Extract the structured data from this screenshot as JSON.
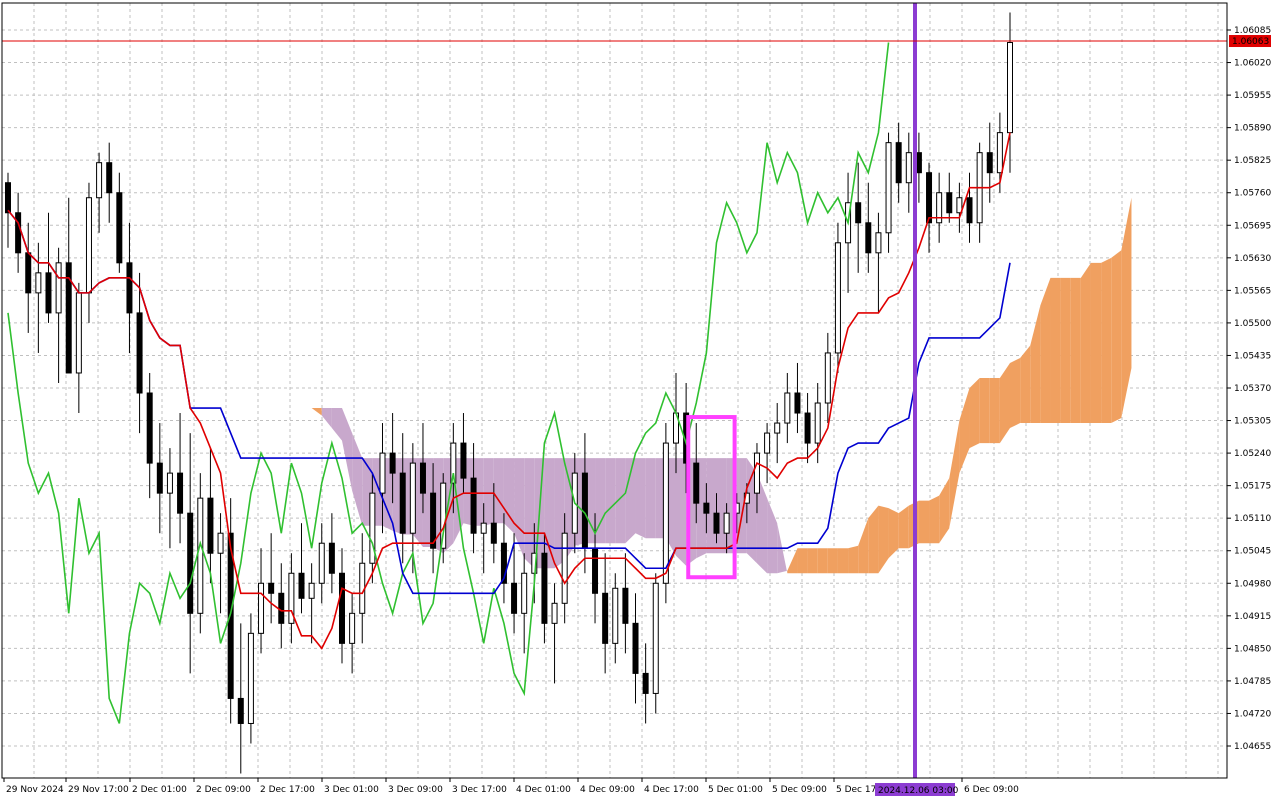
{
  "chart_data": {
    "type": "candlestick",
    "indicator": "ichimoku",
    "grid": true,
    "y_ticks": [
      "1.06085",
      "1.06020",
      "1.05955",
      "1.05890",
      "1.05825",
      "1.05760",
      "1.05695",
      "1.05630",
      "1.05565",
      "1.05500",
      "1.05435",
      "1.05370",
      "1.05305",
      "1.05240",
      "1.05175",
      "1.05110",
      "1.05045",
      "1.04980",
      "1.04915",
      "1.04850",
      "1.04785",
      "1.04720",
      "1.04655"
    ],
    "y_range": [
      1.0462,
      1.0613
    ],
    "x_ticks": [
      "29 Nov 2024",
      "29 Nov 17:00",
      "2 Dec 01:00",
      "2 Dec 09:00",
      "2 Dec 17:00",
      "3 Dec 01:00",
      "3 Dec 09:00",
      "3 Dec 17:00",
      "4 Dec 01:00",
      "4 Dec 09:00",
      "4 Dec 17:00",
      "5 Dec 01:00",
      "5 Dec 09:00",
      "5 Dec 17:00",
      "6 Dec 09:00"
    ],
    "current_price": "1.06063",
    "current_price_value": 1.06063,
    "marker_time": "2024.12.06 03:00",
    "colors": {
      "grid": "#c0c0c0",
      "tenkan": "#e00000",
      "kijun": "#0000d0",
      "chikou": "#30c030",
      "cloud_bull": "#f0a060",
      "cloud_bear": "#c8a8cc",
      "marker_line": "#8c3cd2",
      "highlight": "#ff40ff",
      "bull_candle": "#ffffff",
      "bear_candle": "#000000",
      "price_line": "#e00000"
    },
    "candles_ohlc": [
      [
        1.0578,
        1.058,
        1.0565,
        1.0572
      ],
      [
        1.0572,
        1.0576,
        1.056,
        1.0564
      ],
      [
        1.0564,
        1.057,
        1.0548,
        1.0556
      ],
      [
        1.0556,
        1.0566,
        1.0544,
        1.056
      ],
      [
        1.056,
        1.0572,
        1.055,
        1.0552
      ],
      [
        1.0552,
        1.0565,
        1.0538,
        1.0562
      ],
      [
        1.0562,
        1.0575,
        1.0548,
        1.054
      ],
      [
        1.054,
        1.0558,
        1.0532,
        1.0556
      ],
      [
        1.0556,
        1.0578,
        1.055,
        1.0575
      ],
      [
        1.0575,
        1.0584,
        1.0568,
        1.0582
      ],
      [
        1.0582,
        1.0586,
        1.057,
        1.0576
      ],
      [
        1.0576,
        1.058,
        1.056,
        1.0562
      ],
      [
        1.0562,
        1.057,
        1.0544,
        1.0552
      ],
      [
        1.0552,
        1.056,
        1.0528,
        1.0536
      ],
      [
        1.0536,
        1.054,
        1.0515,
        1.0522
      ],
      [
        1.0522,
        1.053,
        1.0508,
        1.0516
      ],
      [
        1.0516,
        1.0525,
        1.0505,
        1.052
      ],
      [
        1.052,
        1.0532,
        1.0506,
        1.0512
      ],
      [
        1.0512,
        1.0528,
        1.048,
        1.0492
      ],
      [
        1.0492,
        1.052,
        1.0488,
        1.0515
      ],
      [
        1.0515,
        1.0525,
        1.0498,
        1.0504
      ],
      [
        1.0504,
        1.0512,
        1.0492,
        1.0508
      ],
      [
        1.0508,
        1.0515,
        1.047,
        1.0475
      ],
      [
        1.0475,
        1.049,
        1.046,
        1.047
      ],
      [
        1.047,
        1.0492,
        1.0466,
        1.0488
      ],
      [
        1.0488,
        1.0505,
        1.0484,
        1.0498
      ],
      [
        1.0498,
        1.0508,
        1.049,
        1.0496
      ],
      [
        1.0496,
        1.0502,
        1.0485,
        1.049
      ],
      [
        1.049,
        1.0504,
        1.0486,
        1.05
      ],
      [
        1.05,
        1.051,
        1.0492,
        1.0495
      ],
      [
        1.0495,
        1.0502,
        1.0486,
        1.0498
      ],
      [
        1.0498,
        1.051,
        1.0494,
        1.0506
      ],
      [
        1.0506,
        1.0512,
        1.0496,
        1.05
      ],
      [
        1.05,
        1.0505,
        1.0482,
        1.0486
      ],
      [
        1.0486,
        1.0496,
        1.048,
        1.0492
      ],
      [
        1.0492,
        1.0508,
        1.0486,
        1.0502
      ],
      [
        1.0502,
        1.052,
        1.0498,
        1.0516
      ],
      [
        1.0516,
        1.053,
        1.0508,
        1.0524
      ],
      [
        1.0524,
        1.0532,
        1.0514,
        1.052
      ],
      [
        1.052,
        1.0528,
        1.0502,
        1.0508
      ],
      [
        1.0508,
        1.0526,
        1.05,
        1.0522
      ],
      [
        1.0522,
        1.053,
        1.0512,
        1.0516
      ],
      [
        1.0516,
        1.0522,
        1.05,
        1.0505
      ],
      [
        1.0505,
        1.052,
        1.0502,
        1.0518
      ],
      [
        1.0518,
        1.053,
        1.0512,
        1.0526
      ],
      [
        1.0526,
        1.0532,
        1.0516,
        1.0519
      ],
      [
        1.0519,
        1.0526,
        1.0504,
        1.0508
      ],
      [
        1.0508,
        1.0514,
        1.05,
        1.051
      ],
      [
        1.051,
        1.0518,
        1.0502,
        1.0506
      ],
      [
        1.0506,
        1.0512,
        1.0494,
        1.0498
      ],
      [
        1.0498,
        1.0508,
        1.0488,
        1.0492
      ],
      [
        1.0492,
        1.0504,
        1.0484,
        1.05
      ],
      [
        1.05,
        1.051,
        1.0494,
        1.0504
      ],
      [
        1.0504,
        1.0508,
        1.0486,
        1.049
      ],
      [
        1.049,
        1.0498,
        1.0478,
        1.0494
      ],
      [
        1.0494,
        1.0512,
        1.049,
        1.0508
      ],
      [
        1.0508,
        1.0524,
        1.0504,
        1.052
      ],
      [
        1.052,
        1.0528,
        1.05,
        1.0505
      ],
      [
        1.0505,
        1.0512,
        1.049,
        1.0496
      ],
      [
        1.0496,
        1.0504,
        1.048,
        1.0486
      ],
      [
        1.0486,
        1.05,
        1.0482,
        1.0497
      ],
      [
        1.0497,
        1.0504,
        1.0484,
        1.049
      ],
      [
        1.049,
        1.0496,
        1.0474,
        1.048
      ],
      [
        1.048,
        1.0486,
        1.047,
        1.0476
      ],
      [
        1.0476,
        1.05,
        1.0472,
        1.0498
      ],
      [
        1.0498,
        1.053,
        1.0494,
        1.0526
      ],
      [
        1.0526,
        1.054,
        1.052,
        1.0532
      ],
      [
        1.0532,
        1.0538,
        1.0516,
        1.0522
      ],
      [
        1.0522,
        1.053,
        1.051,
        1.0514
      ],
      [
        1.0514,
        1.0518,
        1.0508,
        1.0512
      ],
      [
        1.0512,
        1.0516,
        1.0506,
        1.0508
      ],
      [
        1.0508,
        1.0514,
        1.0504,
        1.0512
      ],
      [
        1.0512,
        1.0516,
        1.0508,
        1.0514
      ],
      [
        1.0514,
        1.0518,
        1.051,
        1.0516
      ],
      [
        1.0516,
        1.0526,
        1.0512,
        1.0524
      ],
      [
        1.0524,
        1.053,
        1.0518,
        1.0528
      ],
      [
        1.0528,
        1.0534,
        1.0522,
        1.053
      ],
      [
        1.053,
        1.054,
        1.0526,
        1.0536
      ],
      [
        1.0536,
        1.0542,
        1.0528,
        1.0532
      ],
      [
        1.0532,
        1.0536,
        1.0522,
        1.0526
      ],
      [
        1.0526,
        1.0538,
        1.0522,
        1.0534
      ],
      [
        1.0534,
        1.0548,
        1.053,
        1.0544
      ],
      [
        1.0544,
        1.057,
        1.054,
        1.0566
      ],
      [
        1.0566,
        1.058,
        1.0556,
        1.0574
      ],
      [
        1.0574,
        1.0582,
        1.056,
        1.057
      ],
      [
        1.057,
        1.0578,
        1.056,
        1.0564
      ],
      [
        1.0564,
        1.0572,
        1.0552,
        1.0568
      ],
      [
        1.0568,
        1.0588,
        1.0564,
        1.0586
      ],
      [
        1.0586,
        1.059,
        1.0574,
        1.0578
      ],
      [
        1.0578,
        1.0588,
        1.0572,
        1.0584
      ],
      [
        1.0584,
        1.0588,
        1.0574,
        1.058
      ],
      [
        1.058,
        1.0582,
        1.0564,
        1.057
      ],
      [
        1.057,
        1.058,
        1.0566,
        1.0576
      ],
      [
        1.0576,
        1.058,
        1.057,
        1.0572
      ],
      [
        1.0572,
        1.0578,
        1.0568,
        1.0575
      ],
      [
        1.0575,
        1.058,
        1.0566,
        1.057
      ],
      [
        1.057,
        1.0586,
        1.0566,
        1.0584
      ],
      [
        1.0584,
        1.059,
        1.0574,
        1.058
      ],
      [
        1.058,
        1.0592,
        1.0576,
        1.0588
      ],
      [
        1.0588,
        1.0612,
        1.058,
        1.0606
      ]
    ]
  }
}
